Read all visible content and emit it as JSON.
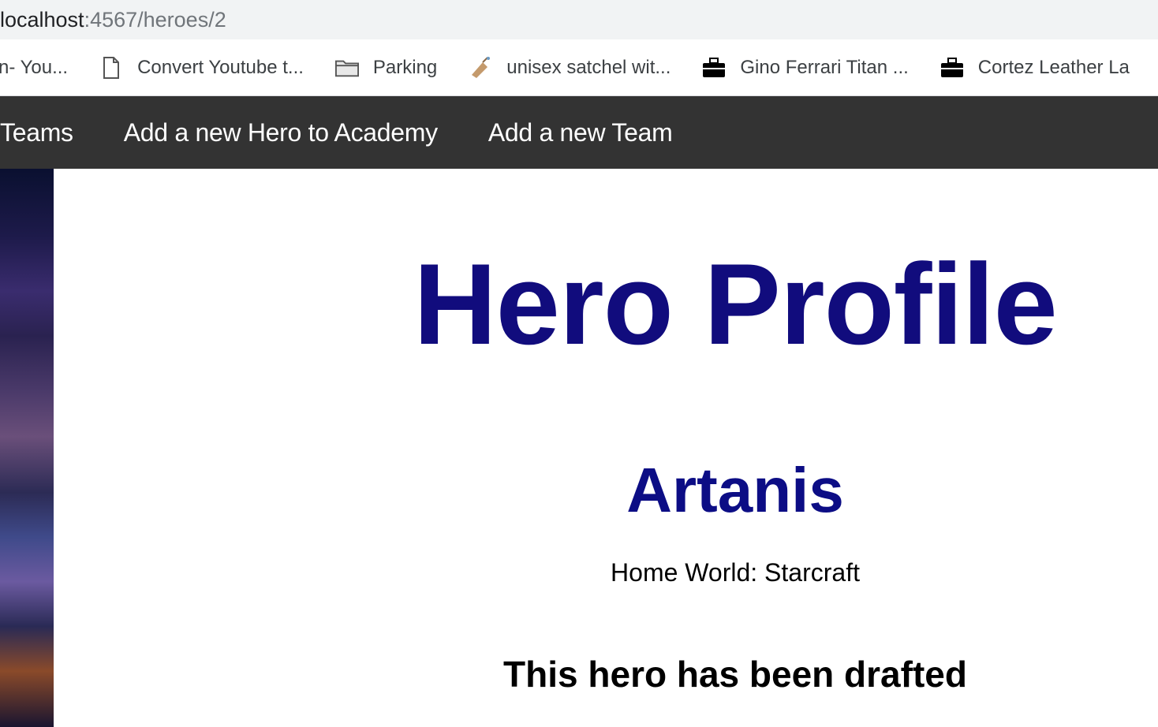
{
  "browser": {
    "url_host": "localhost",
    "url_path": ":4567/heroes/2"
  },
  "bookmarks": [
    {
      "label": "n- You...",
      "icon": "none"
    },
    {
      "label": "Convert Youtube t...",
      "icon": "page-icon"
    },
    {
      "label": "Parking",
      "icon": "folder-icon"
    },
    {
      "label": "unisex satchel wit...",
      "icon": "satchel-favicon"
    },
    {
      "label": "Gino Ferrari Titan ...",
      "icon": "briefcase-favicon"
    },
    {
      "label": "Cortez Leather La",
      "icon": "briefcase-favicon"
    }
  ],
  "nav": {
    "teams": "Teams",
    "add_hero": "Add a new Hero to Academy",
    "add_team": "Add a new Team",
    "background": "#333333"
  },
  "main": {
    "title": "Hero Profile",
    "hero_name": "Artanis",
    "home_world": "Home World: Starcraft",
    "status": "This hero has been drafted"
  },
  "colors": {
    "title": "#110c7d",
    "hero_name": "#0c0d85"
  }
}
